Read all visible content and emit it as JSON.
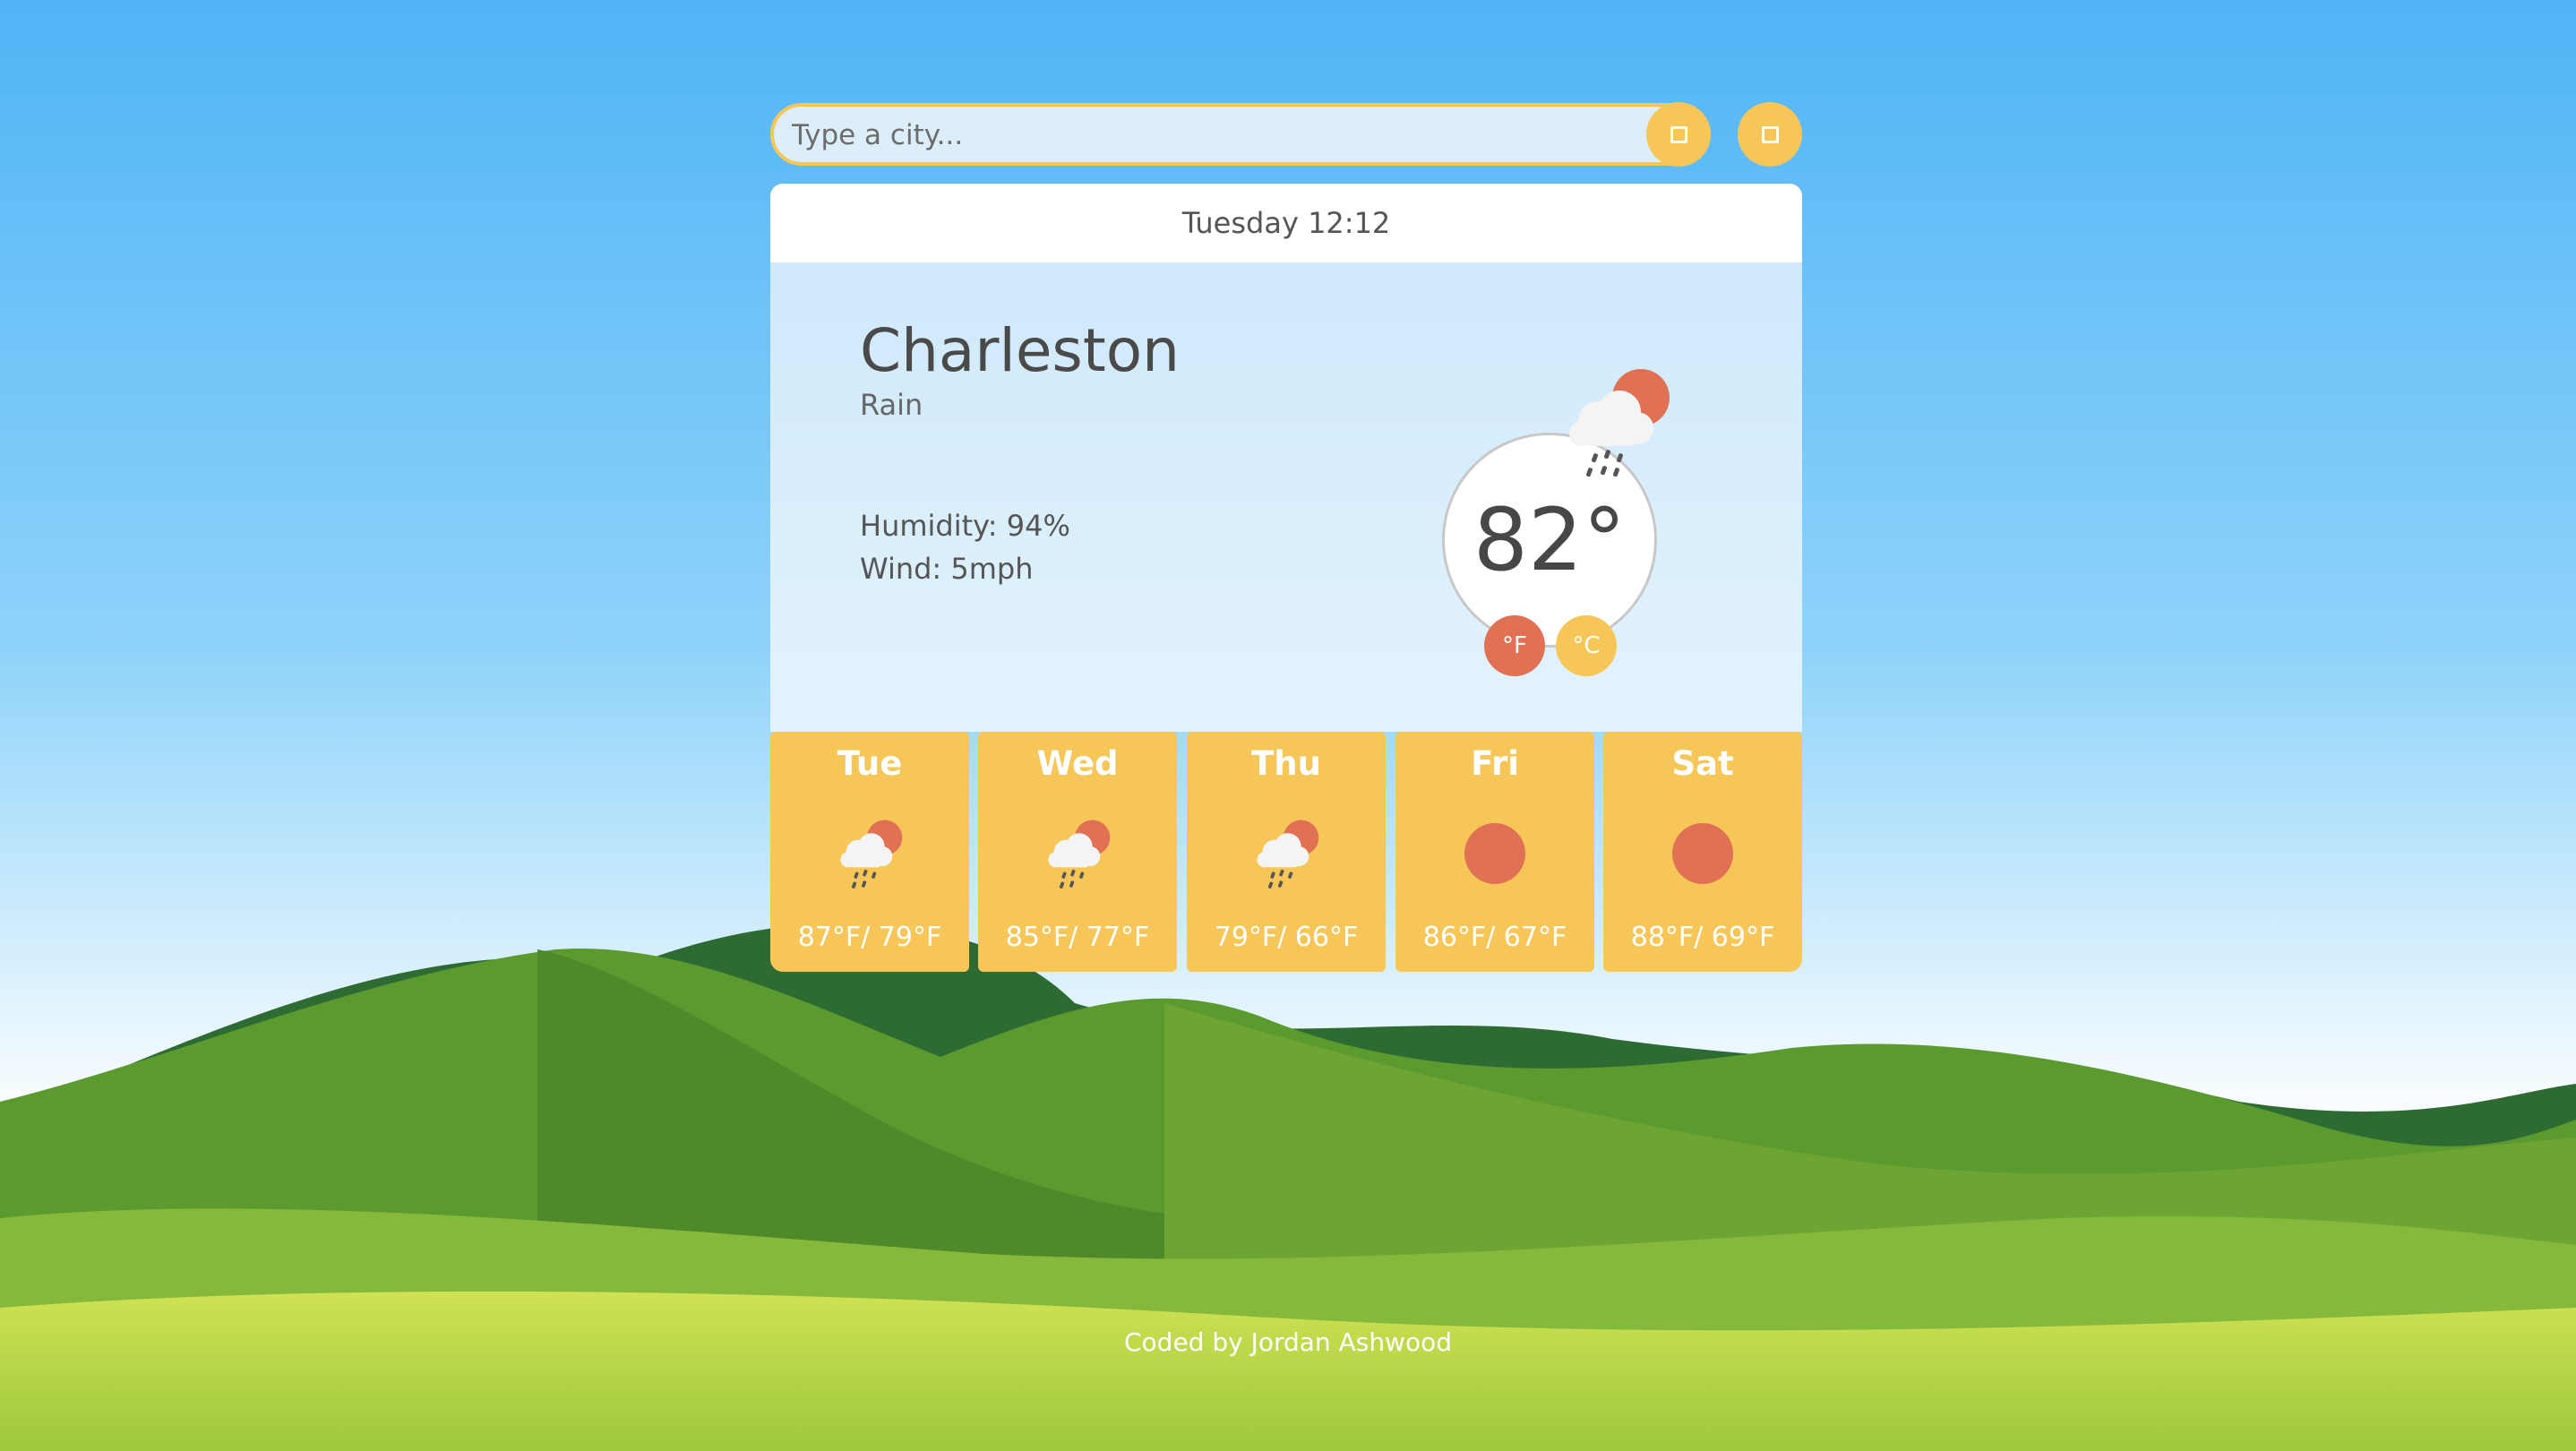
{
  "search": {
    "placeholder": "Type a city..."
  },
  "header": {
    "datetime": "Tuesday 12:12"
  },
  "current": {
    "city": "Charleston",
    "condition": "Rain",
    "humidity": "Humidity: 94%",
    "wind": "Wind: 5mph",
    "temperature": "82°",
    "icon": "rain-cloud-sun-icon"
  },
  "units": {
    "fahrenheit": "°F",
    "celsius": "°C"
  },
  "forecast": [
    {
      "day": "Tue",
      "temps": "87°F/ 79°F",
      "icon": "rain-cloud-sun-icon"
    },
    {
      "day": "Wed",
      "temps": "85°F/ 77°F",
      "icon": "rain-cloud-sun-icon"
    },
    {
      "day": "Thu",
      "temps": "79°F/ 66°F",
      "icon": "rain-cloud-sun-icon"
    },
    {
      "day": "Fri",
      "temps": "86°F/ 67°F",
      "icon": "sun-icon"
    },
    {
      "day": "Sat",
      "temps": "88°F/ 69°F",
      "icon": "sun-icon"
    }
  ],
  "footer": {
    "credit": "Coded by Jordan Ashwood"
  },
  "colors": {
    "accent_yellow": "#f6c659",
    "accent_red": "#e07154",
    "sky_top": "#50b4f6",
    "sky_bottom": "#ffffff"
  }
}
